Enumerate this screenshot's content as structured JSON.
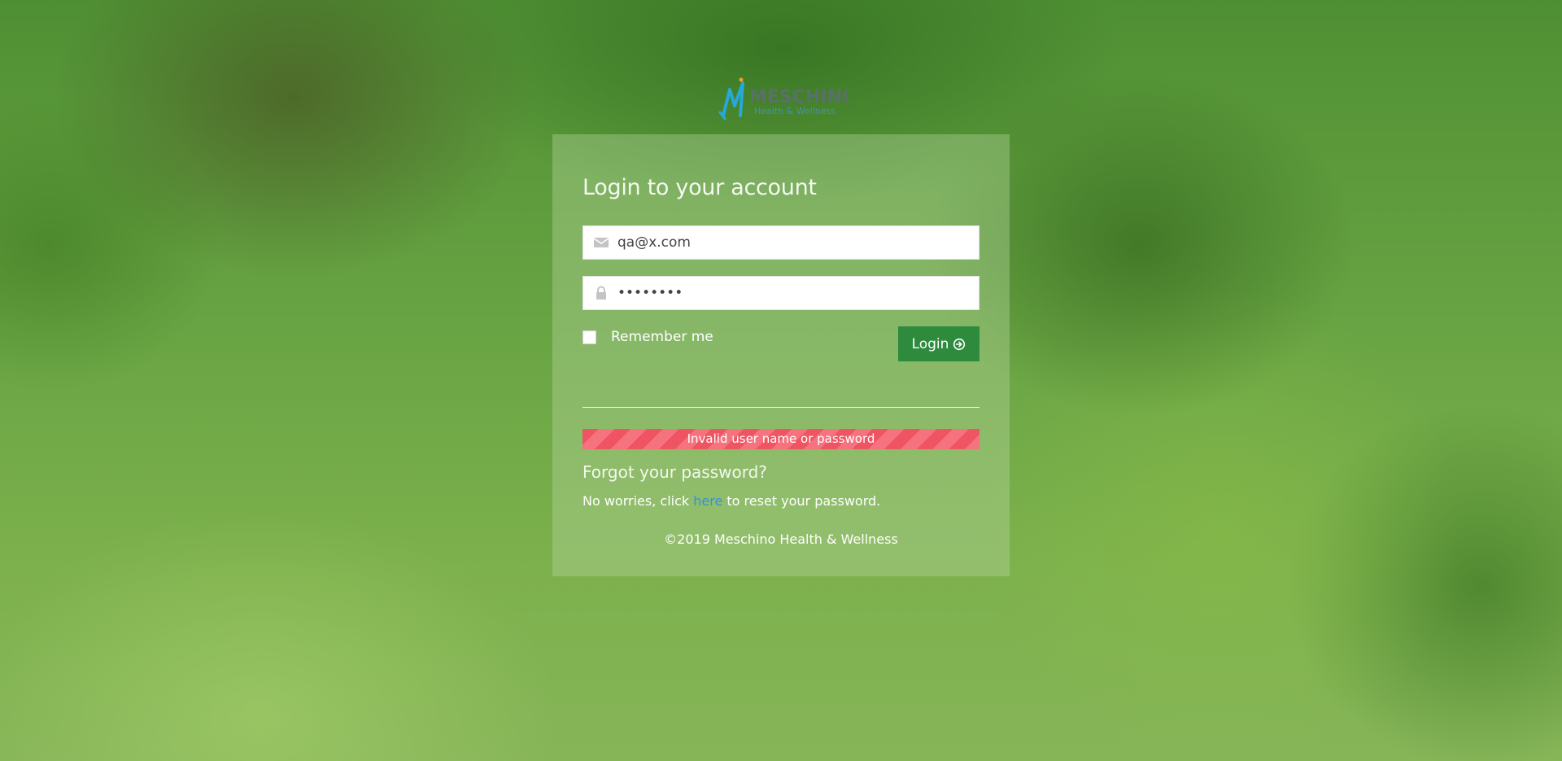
{
  "logo": {
    "name": "MESCHINO",
    "tagline": "Health & Wellness"
  },
  "login": {
    "title": "Login to your account",
    "email_value": "qa@x.com",
    "password_value": "••••••••",
    "remember_label": "Remember me",
    "remember_checked": false,
    "button_label": "Login"
  },
  "error": {
    "message": "Invalid user name or password"
  },
  "forgot": {
    "title": "Forgot your password?",
    "text_before": "No worries, click ",
    "link_text": "here",
    "text_after": " to reset your password."
  },
  "footer": {
    "copyright": "©2019 Meschino Health & Wellness"
  },
  "icons": {
    "email": "envelope-icon",
    "password": "lock-icon",
    "login": "circle-arrow-right-icon"
  },
  "colors": {
    "login_button": "#2e8b3e",
    "error_background": "#ef5462",
    "link": "#3d8fd6"
  }
}
